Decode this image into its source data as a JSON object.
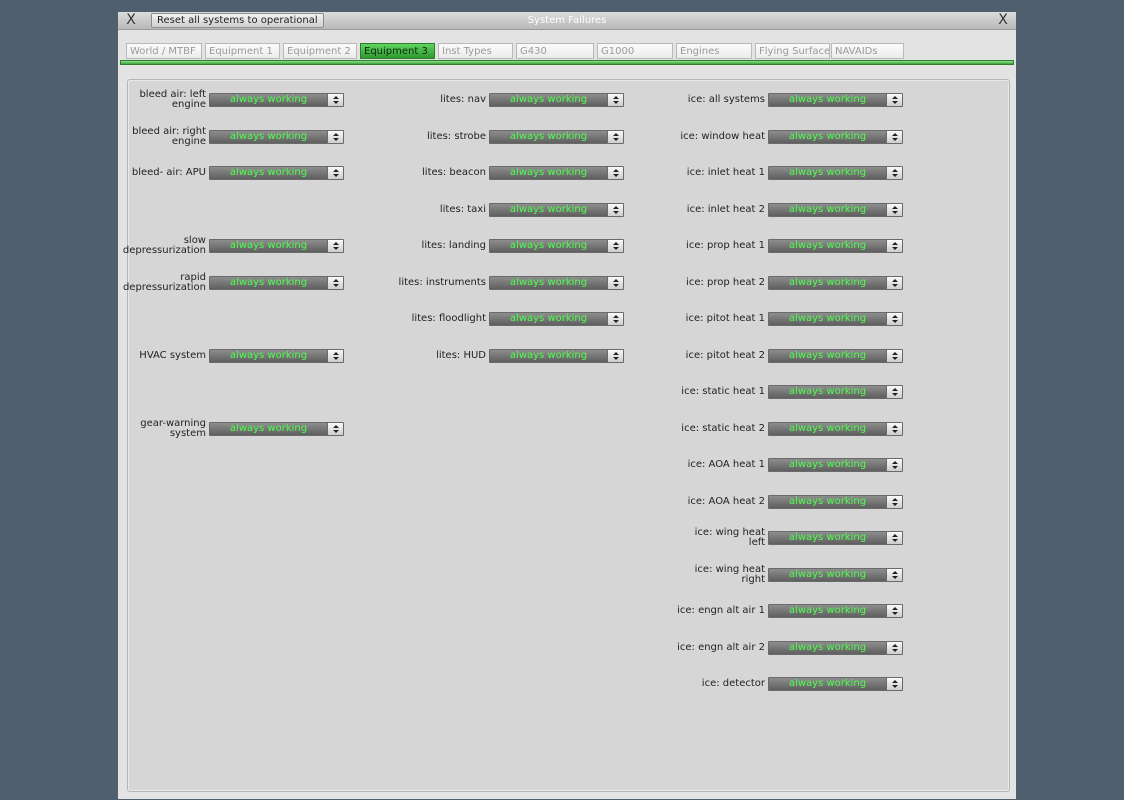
{
  "window": {
    "title": "System Failures",
    "reset_label": "Reset all systems to operational",
    "close_glyph": "X"
  },
  "tabs": [
    {
      "label": "World / MTBF",
      "active": false
    },
    {
      "label": "Equipment 1",
      "active": false
    },
    {
      "label": "Equipment 2",
      "active": false
    },
    {
      "label": "Equipment 3",
      "active": true
    },
    {
      "label": "Inst Types",
      "active": false
    },
    {
      "label": "G430",
      "active": false
    },
    {
      "label": "G1000",
      "active": false
    },
    {
      "label": "Engines",
      "active": false
    },
    {
      "label": "Flying Surfaces",
      "active": false
    },
    {
      "label": "NAVAIDs",
      "active": false
    }
  ],
  "columns": [
    [
      {
        "label": "bleed air: left engine",
        "value": "always working"
      },
      {
        "label": "bleed air: right engine",
        "value": "always working"
      },
      {
        "label": "bleed- air: APU",
        "value": "always working"
      },
      null,
      {
        "label": "slow depressurization",
        "value": "always working"
      },
      {
        "label": "rapid depressurization",
        "value": "always working"
      },
      null,
      {
        "label": "HVAC system",
        "value": "always working"
      },
      null,
      {
        "label": "gear-warning system",
        "value": "always working"
      }
    ],
    [
      {
        "label": "lites: nav",
        "value": "always working"
      },
      {
        "label": "lites: strobe",
        "value": "always working"
      },
      {
        "label": "lites: beacon",
        "value": "always working"
      },
      {
        "label": "lites: taxi",
        "value": "always working"
      },
      {
        "label": "lites: landing",
        "value": "always working"
      },
      {
        "label": "lites: instruments",
        "value": "always working"
      },
      {
        "label": "lites: floodlight",
        "value": "always working"
      },
      {
        "label": "lites: HUD",
        "value": "always working"
      }
    ],
    [
      {
        "label": "ice: all systems",
        "value": "always working"
      },
      {
        "label": "ice: window heat",
        "value": "always working"
      },
      {
        "label": "ice: inlet heat 1",
        "value": "always working"
      },
      {
        "label": "ice: inlet heat 2",
        "value": "always working"
      },
      {
        "label": "ice: prop heat 1",
        "value": "always working"
      },
      {
        "label": "ice: prop heat 2",
        "value": "always working"
      },
      {
        "label": "ice: pitot heat 1",
        "value": "always working"
      },
      {
        "label": "ice: pitot heat 2",
        "value": "always working"
      },
      {
        "label": "ice: static heat 1",
        "value": "always working"
      },
      {
        "label": "ice: static heat 2",
        "value": "always working"
      },
      {
        "label": "ice: AOA heat 1",
        "value": "always working"
      },
      {
        "label": "ice: AOA heat 2",
        "value": "always working"
      },
      {
        "label": "ice: wing heat left",
        "value": "always working"
      },
      {
        "label": "ice: wing heat right",
        "value": "always working"
      },
      {
        "label": "ice: engn alt air 1",
        "value": "always working"
      },
      {
        "label": "ice: engn alt air 2",
        "value": "always working"
      },
      {
        "label": "ice: detector",
        "value": "always working"
      }
    ]
  ],
  "colors": {
    "active_tab": "#3aa43a",
    "dropdown_text": "#4dff4d",
    "desktop": "#4f5f6e"
  }
}
